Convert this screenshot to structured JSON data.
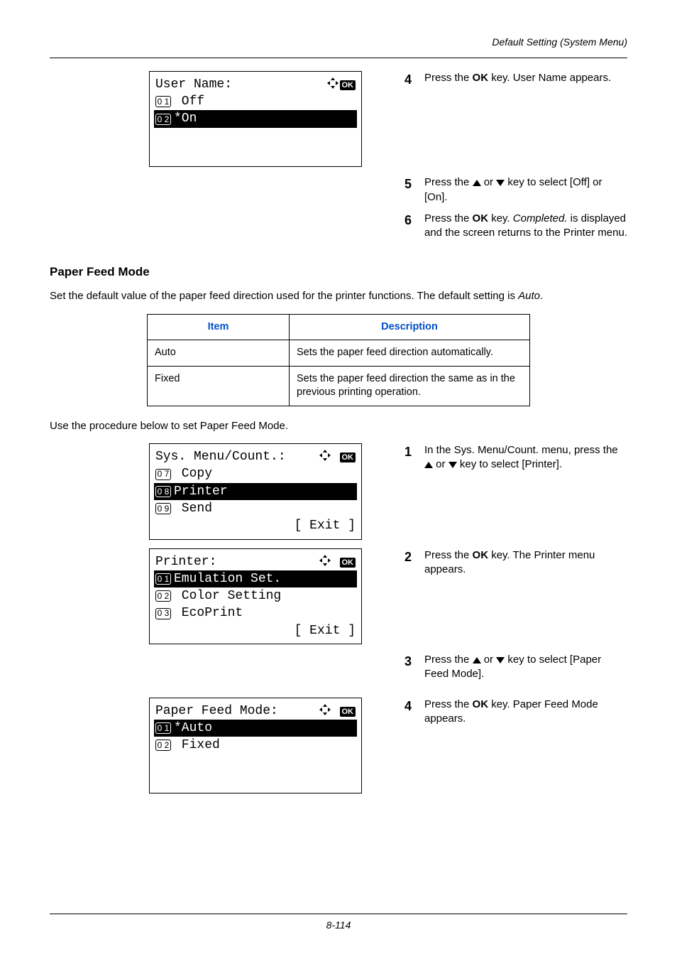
{
  "header": {
    "section": "Default Setting (System Menu)"
  },
  "lcd1": {
    "title": "User Name:",
    "row1_num": "0 1",
    "row1_text": " Off",
    "row2_num": "0 2",
    "row2_text": "*On"
  },
  "steps_top": {
    "s4_num": "4",
    "s4_text_a": "Press the ",
    "s4_ok": "OK",
    "s4_text_b": " key. User Name appears.",
    "s5_num": "5",
    "s5_text_a": "Press the ",
    "s5_text_b": " or ",
    "s5_text_c": " key to select [Off] or [On].",
    "s6_num": "6",
    "s6_text_a": "Press the ",
    "s6_ok": "OK",
    "s6_text_b": " key. ",
    "s6_completed": "Completed.",
    "s6_text_c": " is displayed and the screen returns to the Printer menu."
  },
  "paper_feed": {
    "title": "Paper Feed Mode",
    "intro_a": "Set the default value of the paper feed direction used for the printer functions. The default setting is ",
    "intro_auto": "Auto",
    "intro_b": "."
  },
  "table": {
    "hdr_item": "Item",
    "hdr_desc": "Description",
    "r1_item": "Auto",
    "r1_desc": "Sets the paper feed direction automatically.",
    "r2_item": "Fixed",
    "r2_desc": "Sets the paper feed direction the same as in the previous printing operation."
  },
  "procedure_intro": "Use the procedure below to set Paper Feed Mode.",
  "lcd2": {
    "title": "Sys. Menu/Count.:",
    "row1_num": "0 7",
    "row1_text": " Copy",
    "row2_num": "0 8",
    "row2_text": " Printer",
    "row3_num": "0 9",
    "row3_text": " Send",
    "exit": "[  Exit  ]"
  },
  "lcd3": {
    "title": "Printer:",
    "row1_num": "0 1",
    "row1_text": " Emulation Set.",
    "row2_num": "0 2",
    "row2_text": " Color Setting",
    "row3_num": "0 3",
    "row3_text": " EcoPrint",
    "exit": "[  Exit  ]"
  },
  "lcd4": {
    "title": "Paper Feed Mode:",
    "row1_num": "0 1",
    "row1_text": "*Auto",
    "row2_num": "0 2",
    "row2_text": " Fixed"
  },
  "steps_bottom": {
    "s1_num": "1",
    "s1_text_a": "In the Sys. Menu/Count. menu, press the ",
    "s1_text_b": " or ",
    "s1_text_c": " key to select [Printer].",
    "s2_num": "2",
    "s2_text_a": "Press the ",
    "s2_ok": "OK",
    "s2_text_b": " key. The Printer menu appears.",
    "s3_num": "3",
    "s3_text_a": "Press the ",
    "s3_text_b": " or ",
    "s3_text_c": " key to select [Paper Feed Mode].",
    "s4_num": "4",
    "s4_text_a": "Press the ",
    "s4_ok": "OK",
    "s4_text_b": " key. Paper Feed Mode appears."
  },
  "footer": {
    "page": "8-114"
  }
}
